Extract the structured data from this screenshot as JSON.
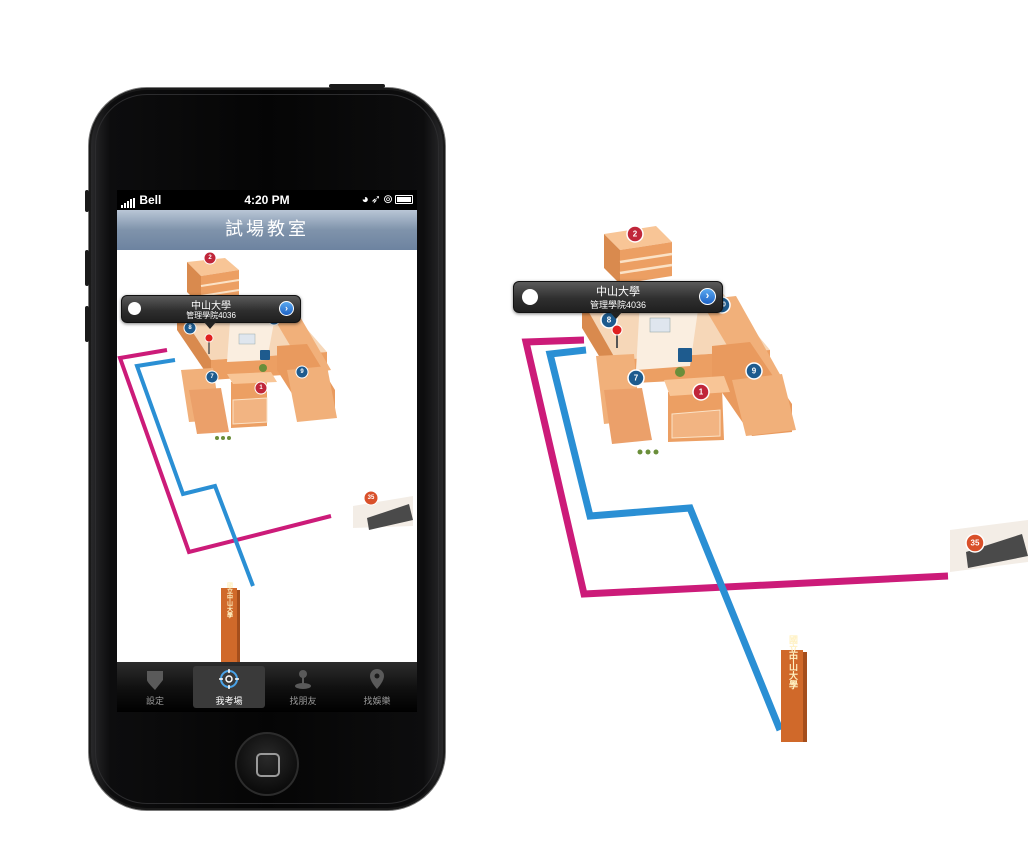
{
  "status_bar": {
    "carrier": "Bell",
    "time": "4:20 PM"
  },
  "nav": {
    "title": "試場教室"
  },
  "callout": {
    "title": "中山大學",
    "subtitle": "管理學院4036",
    "info_icon": "chevron-right-icon",
    "avatar_icon": "person-icon"
  },
  "tabs": [
    {
      "label": "設定",
      "icon": "shield-icon",
      "active": false
    },
    {
      "label": "我考場",
      "icon": "crosshair-icon",
      "active": true
    },
    {
      "label": "找朋友",
      "icon": "joystick-icon",
      "active": false
    },
    {
      "label": "找娛樂",
      "icon": "location-pin-icon",
      "active": false
    }
  ],
  "map_markers": [
    "2",
    "8",
    "10",
    "7",
    "9",
    "1",
    "35"
  ],
  "monument": {
    "text": "國立中山大學"
  },
  "routes": [
    {
      "color": "#cc1b79"
    },
    {
      "color": "#2a8fd4"
    }
  ],
  "colors": {
    "nav_bar": "#7f93ab",
    "marker_red": "#c0263a",
    "marker_blue": "#1e5b8e",
    "building": "#f1b07a"
  }
}
